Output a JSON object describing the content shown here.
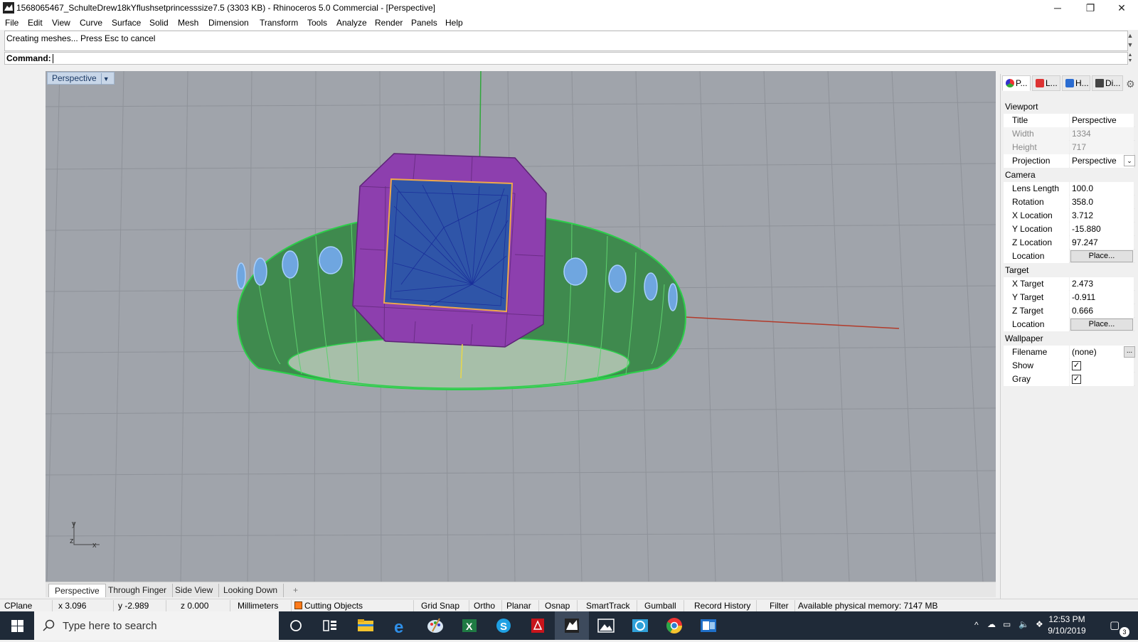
{
  "window": {
    "title": "1568065467_SchulteDrew18kYflushsetprincesssize7.5 (3303 KB) - Rhinoceros 5.0 Commercial - [Perspective]",
    "minimize": "─",
    "maximize": "❐",
    "close": "✕"
  },
  "menu": [
    "File",
    "Edit",
    "View",
    "Curve",
    "Surface",
    "Solid",
    "Mesh",
    "Dimension",
    "Transform",
    "Tools",
    "Analyze",
    "Render",
    "Panels",
    "Help"
  ],
  "command": {
    "history": "Creating meshes... Press Esc to cancel",
    "label": "Command:",
    "value": ""
  },
  "viewport": {
    "label": "Perspective",
    "axis_y": "y",
    "axis_x": "x",
    "axis_z": "z"
  },
  "viewport_tabs": [
    "Perspective",
    "Through Finger",
    "Side View",
    "Looking Down"
  ],
  "viewport_tab_add": "+",
  "panel": {
    "tabs": [
      "P...",
      "L...",
      "H...",
      "Di..."
    ],
    "viewport_section": "Viewport",
    "title_label": "Title",
    "title_value": "Perspective",
    "width_label": "Width",
    "width_value": "1334",
    "height_label": "Height",
    "height_value": "717",
    "projection_label": "Projection",
    "projection_value": "Perspective",
    "camera_section": "Camera",
    "lens_label": "Lens Length",
    "lens_value": "100.0",
    "rotation_label": "Rotation",
    "rotation_value": "358.0",
    "xloc_label": "X Location",
    "xloc_value": "3.712",
    "yloc_label": "Y Location",
    "yloc_value": "-15.880",
    "zloc_label": "Z Location",
    "zloc_value": "97.247",
    "location_label": "Location",
    "place_button": "Place...",
    "target_section": "Target",
    "xt_label": "X Target",
    "xt_value": "2.473",
    "yt_label": "Y Target",
    "yt_value": "-0.911",
    "zt_label": "Z Target",
    "zt_value": "0.666",
    "tlocation_label": "Location",
    "tplace_button": "Place...",
    "wallpaper_section": "Wallpaper",
    "filename_label": "Filename",
    "filename_value": "(none)",
    "filename_button": "...",
    "show_label": "Show",
    "show_checked": true,
    "gray_label": "Gray",
    "gray_checked": true
  },
  "status": {
    "cplane": "CPlane",
    "x": "x 3.096",
    "y": "y -2.989",
    "z": "z 0.000",
    "units": "Millimeters",
    "layer": "Cutting Objects",
    "layer_color": "#ff7a1a",
    "grid_snap": "Grid Snap",
    "ortho": "Ortho",
    "planar": "Planar",
    "osnap": "Osnap",
    "smarttrack": "SmartTrack",
    "gumball": "Gumball",
    "record_history": "Record History",
    "filter": "Filter",
    "memory": "Available physical memory: 7147 MB"
  },
  "taskbar": {
    "search_placeholder": "Type here to search",
    "time": "12:53 PM",
    "date": "9/10/2019",
    "notifications": "3"
  },
  "colors": {
    "viewport_bg": "#a0a4ab",
    "ring_green": "#3f8a4e",
    "setting_purple": "#8d3fae",
    "stone_blue": "#2f55a8",
    "accent": "#1b3a66"
  }
}
